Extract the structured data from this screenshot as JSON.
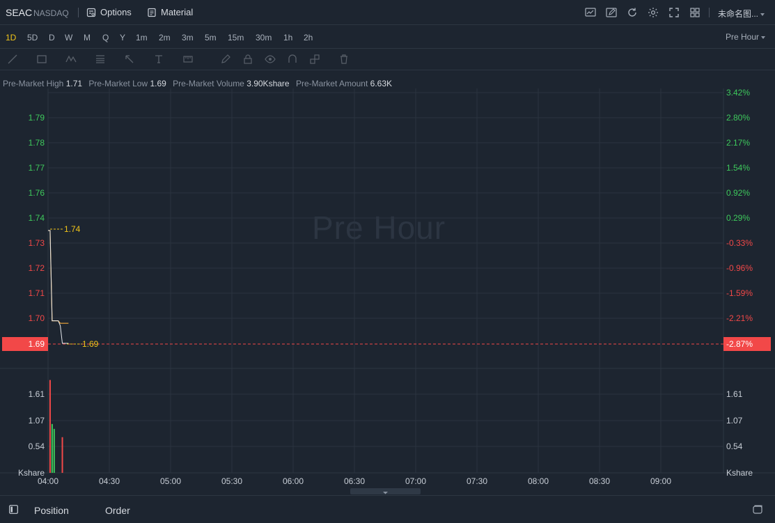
{
  "header": {
    "symbol": "SEAC",
    "exchange": "NASDAQ",
    "options_label": "Options",
    "material_label": "Material",
    "chart_name": "未命名图..."
  },
  "periods": [
    "1D",
    "5D",
    "D",
    "W",
    "M",
    "Q",
    "Y",
    "1m",
    "2m",
    "3m",
    "5m",
    "15m",
    "30m",
    "1h",
    "2h"
  ],
  "active_period": "1D",
  "session_select": "Pre Hour",
  "premarket": {
    "high_label": "Pre-Market High",
    "high": "1.71",
    "low_label": "Pre-Market Low",
    "low": "1.69",
    "volume_label": "Pre-Market Volume",
    "volume": "3.90Kshare",
    "amount_label": "Pre-Market Amount",
    "amount": "6.63K"
  },
  "watermark": "Pre Hour",
  "chart_data": {
    "type": "line",
    "x_labels": [
      "04:00",
      "04:30",
      "05:00",
      "05:30",
      "06:00",
      "06:30",
      "07:00",
      "07:30",
      "08:00",
      "08:30",
      "09:00"
    ],
    "price_ticks": [
      "1.79",
      "1.78",
      "1.77",
      "1.76",
      "1.74",
      "1.73",
      "1.72",
      "1.71",
      "1.70"
    ],
    "pct_ticks": [
      "3.42%",
      "2.80%",
      "2.17%",
      "1.54%",
      "0.92%",
      "0.29%",
      "-0.33%",
      "-0.96%",
      "-1.59%",
      "-2.21%"
    ],
    "last_price": "1.69",
    "last_pct": "-2.87%",
    "open_marker": "1.74",
    "last_marker": "1.69",
    "volume_ticks": [
      "1.61",
      "1.07",
      "0.54"
    ],
    "volume_unit": "Kshare",
    "price_series": [
      {
        "t": "04:00",
        "v": 1.735
      },
      {
        "t": "04:01",
        "v": 1.735
      },
      {
        "t": "04:02",
        "v": 1.699
      },
      {
        "t": "04:05",
        "v": 1.699
      },
      {
        "t": "04:06",
        "v": 1.697
      },
      {
        "t": "04:07",
        "v": 1.69
      },
      {
        "t": "04:10",
        "v": 1.69
      }
    ],
    "avg_series": [
      {
        "t": "04:00",
        "v": 1.735
      },
      {
        "t": "04:01",
        "v": 1.735
      },
      {
        "t": "04:02",
        "v": 1.699
      },
      {
        "t": "04:05",
        "v": 1.699
      },
      {
        "t": "04:06",
        "v": 1.698
      },
      {
        "t": "04:10",
        "v": 1.698
      }
    ],
    "volume_bars": [
      {
        "t": "04:01",
        "v": 1.9,
        "dir": "down"
      },
      {
        "t": "04:02",
        "v": 1.0,
        "dir": "up"
      },
      {
        "t": "04:03",
        "v": 0.9,
        "dir": "up"
      },
      {
        "t": "04:07",
        "v": 0.73,
        "dir": "down"
      }
    ],
    "colors": {
      "up": "#3ec95c",
      "down": "#f24848",
      "price_line": "#e6e9ee",
      "avg_line": "#f2a93b",
      "marker": "#f0c419"
    }
  },
  "bottom": {
    "position_label": "Position",
    "order_label": "Order"
  }
}
